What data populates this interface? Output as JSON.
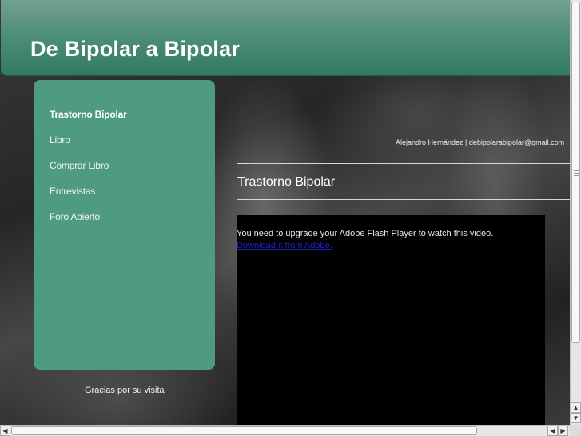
{
  "header": {
    "title": "De Bipolar a Bipolar"
  },
  "sidebar": {
    "items": [
      {
        "label": "Trastorno Bipolar",
        "active": true
      },
      {
        "label": "Libro",
        "active": false
      },
      {
        "label": "Comprar Libro",
        "active": false
      },
      {
        "label": "Entrevistas",
        "active": false
      },
      {
        "label": "Foro Abierto",
        "active": false
      }
    ],
    "footer": "Gracias por su visita"
  },
  "main": {
    "contact": "Alejandro Hernández | debipolarabipolar@gmail.com",
    "heading": "Trastorno Bipolar",
    "flash_message": "You need to upgrade your Adobe Flash Player to watch this video.",
    "flash_link": "Download it from Adobe."
  },
  "colors": {
    "header": "#4f8f79",
    "sidebar": "#4f9a82",
    "video_bg": "#000000",
    "link": "#2020c8"
  },
  "icons": {
    "scroll_up": "▲",
    "scroll_down": "▼",
    "scroll_left": "◀",
    "scroll_right": "▶"
  }
}
